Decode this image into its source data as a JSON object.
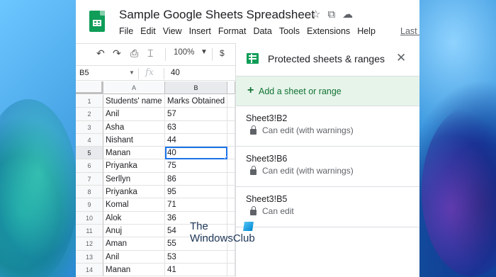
{
  "header": {
    "doc_title": "Sample Google Sheets Spreadsheet",
    "menu": [
      "File",
      "Edit",
      "View",
      "Insert",
      "Format",
      "Data",
      "Tools",
      "Extensions",
      "Help"
    ],
    "last_edit": "Last e"
  },
  "toolbar": {
    "zoom": "100%",
    "currency": "$"
  },
  "formula_bar": {
    "cell_ref": "B5",
    "fx": "fx",
    "value": "40"
  },
  "grid": {
    "columns": [
      "A",
      "B"
    ],
    "rows": [
      {
        "n": "1",
        "a": "Students' name",
        "b": "Marks Obtained"
      },
      {
        "n": "2",
        "a": "Anil",
        "b": "57"
      },
      {
        "n": "3",
        "a": "Asha",
        "b": "63"
      },
      {
        "n": "4",
        "a": "Nishant",
        "b": "44"
      },
      {
        "n": "5",
        "a": "Manan",
        "b": "40"
      },
      {
        "n": "6",
        "a": "Priyanka",
        "b": "75"
      },
      {
        "n": "7",
        "a": "Serllyn",
        "b": "86"
      },
      {
        "n": "8",
        "a": "Priyanka",
        "b": "95"
      },
      {
        "n": "9",
        "a": "Komal",
        "b": "71"
      },
      {
        "n": "10",
        "a": "Alok",
        "b": "36"
      },
      {
        "n": "11",
        "a": "Anuj",
        "b": "54"
      },
      {
        "n": "12",
        "a": "Aman",
        "b": "55"
      },
      {
        "n": "13",
        "a": "Anil",
        "b": "53"
      },
      {
        "n": "14",
        "a": "Manan",
        "b": "41"
      }
    ]
  },
  "panel": {
    "title": "Protected sheets & ranges",
    "add_label": "Add a sheet or range",
    "items": [
      {
        "range": "Sheet3!B2",
        "permission": "Can edit (with warnings)"
      },
      {
        "range": "Sheet3!B6",
        "permission": "Can edit (with warnings)"
      },
      {
        "range": "Sheet3!B5",
        "permission": "Can edit"
      }
    ]
  },
  "watermark": {
    "line1": "The",
    "line2": "WindowsClub"
  },
  "colors": {
    "accent": "#1a73e8",
    "sheets_green": "#0f9d58",
    "add_row_bg": "#e6f4ea",
    "add_row_text": "#137333"
  }
}
